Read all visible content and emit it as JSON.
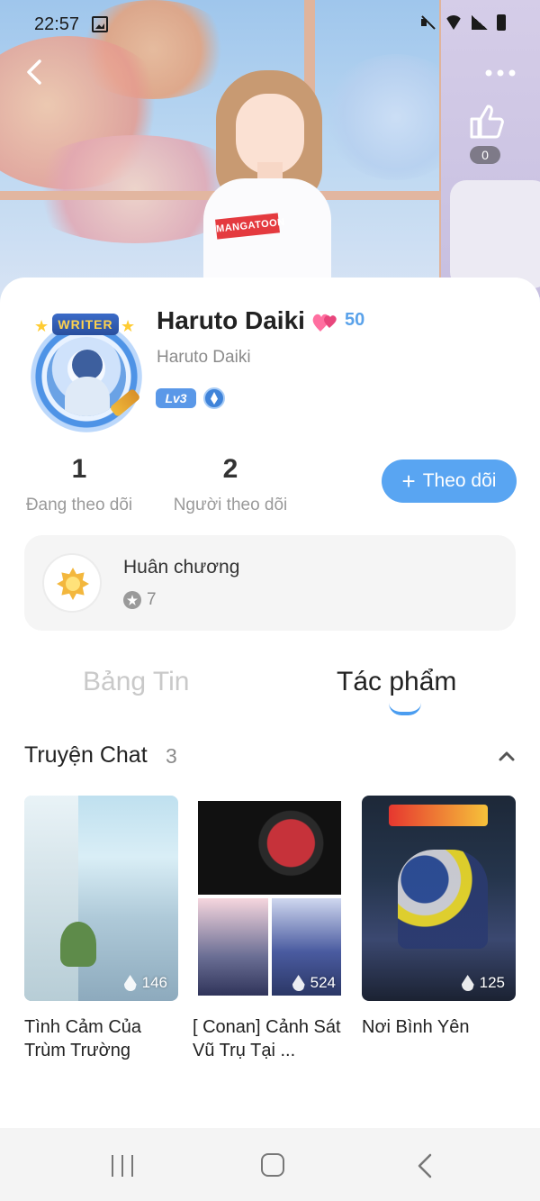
{
  "status_bar": {
    "time": "22:57",
    "icons": [
      "gallery-icon",
      "mute-icon",
      "wifi-icon",
      "signal-icon",
      "battery-icon"
    ]
  },
  "header": {
    "back_icon": "back-arrow-icon",
    "more_icon": "more-dots-icon",
    "like_icon": "thumbs-up-icon",
    "like_count": "0",
    "shirt_text": "MANGATOON"
  },
  "profile": {
    "badge_text": "WRITER",
    "name": "Haruto Daiki",
    "hearts_icon": "hearts-icon",
    "hearts_count": "50",
    "handle": "Haruto Daiki",
    "level": "Lv3",
    "extra_badge_icon": "ethereum-badge-icon"
  },
  "stats": {
    "following": {
      "value": "1",
      "label": "Đang theo dõi"
    },
    "followers": {
      "value": "2",
      "label": "Người theo dõi"
    }
  },
  "follow_button": {
    "icon": "plus-icon",
    "label": "Theo dõi"
  },
  "medals": {
    "title": "Huân chương",
    "count": "7",
    "count_icon": "star-icon"
  },
  "tabs": [
    {
      "label": "Bảng Tin",
      "active": false
    },
    {
      "label": "Tác phẩm",
      "active": true
    }
  ],
  "section": {
    "title": "Truyện Chat",
    "count": "3",
    "toggle_icon": "chevron-up-icon"
  },
  "stories": [
    {
      "title": "Tình Cảm Của Trùm Trường",
      "views": "146"
    },
    {
      "title": "[ Conan] Cảnh Sát Vũ Trụ Tại ...",
      "views": "524"
    },
    {
      "title": "Nơi Bình Yên",
      "views": "125"
    }
  ],
  "colors": {
    "accent": "#59a5f2",
    "level_badge": "#5a98e8",
    "hearts_count": "#5aa2ea",
    "tab_inactive": "#c9c9c9"
  },
  "nav_bar": {
    "icons": [
      "recent-apps-icon",
      "home-icon",
      "back-icon"
    ]
  }
}
